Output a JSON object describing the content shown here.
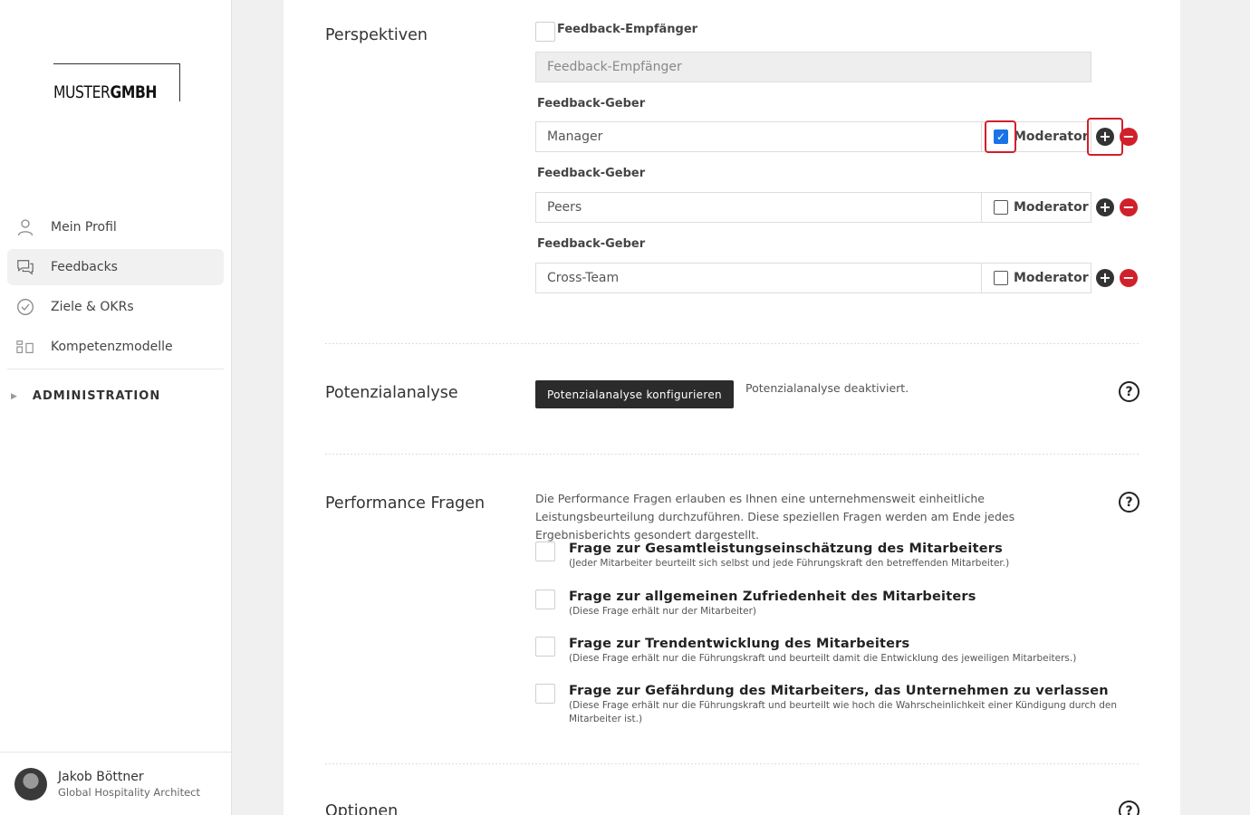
{
  "sidebar": {
    "logo": {
      "part1": "MUSTER",
      "part2": "GMBH"
    },
    "nav": [
      {
        "label": "Mein Profil",
        "icon": "user-icon"
      },
      {
        "label": "Feedbacks",
        "icon": "chat-icon"
      },
      {
        "label": "Ziele & OKRs",
        "icon": "check-circle-icon"
      },
      {
        "label": "Kompetenzmodelle",
        "icon": "blocks-icon"
      }
    ],
    "admin": {
      "label": "ADMINISTRATION"
    },
    "user": {
      "name": "Jakob Böttner",
      "role": "Global Hospitality Architect"
    }
  },
  "perspektiven": {
    "title": "Perspektiven",
    "recipient_checkbox_label": "Feedback-Empfänger",
    "recipient_field": "Feedback-Empfänger",
    "givers": [
      {
        "label": "Feedback-Geber",
        "value": "Manager",
        "moderator_label": "Moderator",
        "moderator": true
      },
      {
        "label": "Feedback-Geber",
        "value": "Peers",
        "moderator_label": "Moderator",
        "moderator": false
      },
      {
        "label": "Feedback-Geber",
        "value": "Cross-Team",
        "moderator_label": "Moderator",
        "moderator": false
      }
    ]
  },
  "potenzial": {
    "title": "Potenzialanalyse",
    "button": "Potenzialanalyse konfigurieren",
    "status": "Potenzialanalyse deaktiviert."
  },
  "performance": {
    "title": "Performance Fragen",
    "description": "Die Performance Fragen erlauben es Ihnen eine unternehmensweit einheitliche Leistungsbeurteilung durchzuführen. Diese speziellen Fragen werden am Ende jedes Ergebnisberichts gesondert dargestellt.",
    "questions": [
      {
        "title": "Frage zur Gesamtleistungseinschätzung des Mitarbeiters",
        "subtitle": "(Jeder Mitarbeiter beurteilt sich selbst und jede Führungskraft den betreffenden Mitarbeiter.)"
      },
      {
        "title": "Frage zur allgemeinen Zufriedenheit des Mitarbeiters",
        "subtitle": "(Diese Frage erhält nur der Mitarbeiter)"
      },
      {
        "title": "Frage zur Trendentwicklung des Mitarbeiters",
        "subtitle": "(Diese Frage erhält nur die Führungskraft und beurteilt damit die Entwicklung des jeweiligen Mitarbeiters.)"
      },
      {
        "title": "Frage zur Gefährdung des Mitarbeiters, das Unternehmen zu verlassen",
        "subtitle": "(Diese Frage erhält nur die Führungskraft und beurteilt wie hoch die Wahrscheinlichkeit einer Kündigung durch den Mitarbeiter ist.)"
      }
    ]
  },
  "optionen": {
    "title": "Optionen"
  },
  "help_symbol": "?",
  "colors": {
    "accent_red": "#d0202b",
    "checkbox_blue": "#1a73e8",
    "dark_button": "#2b2b2b"
  }
}
